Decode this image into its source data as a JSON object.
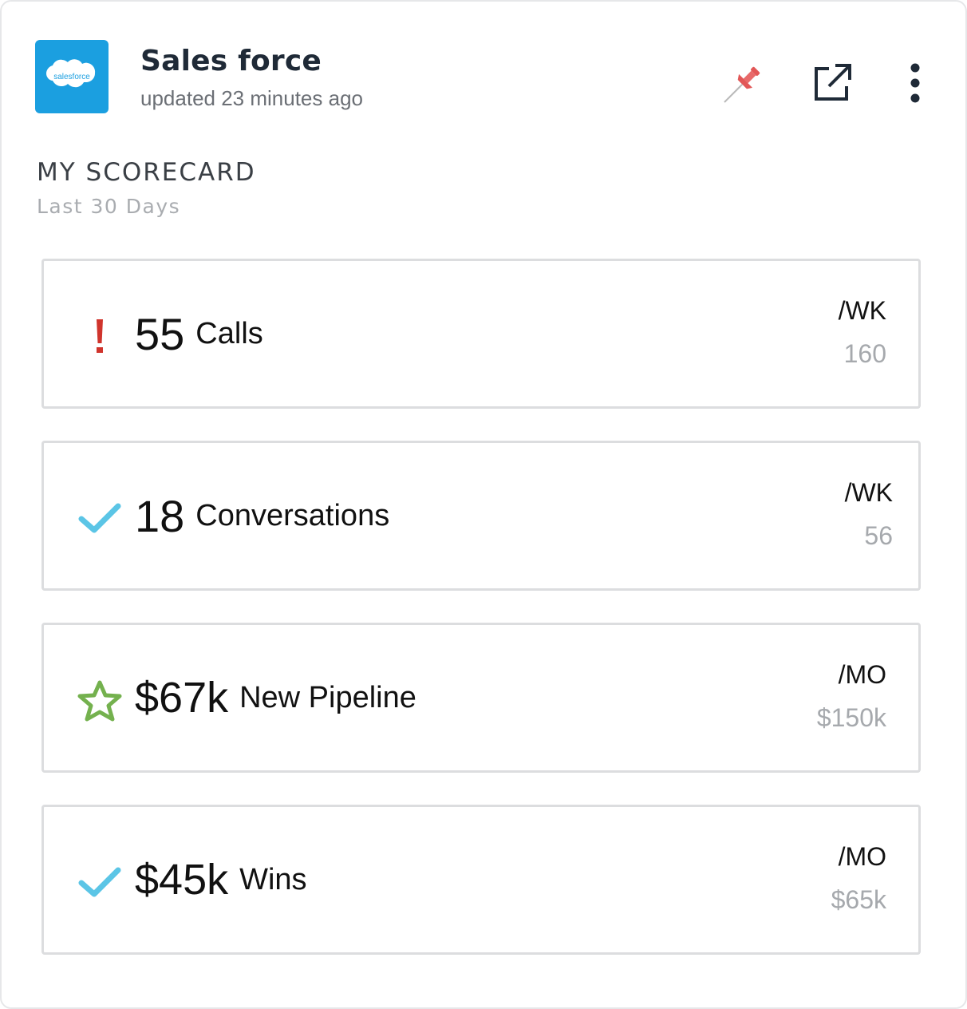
{
  "header": {
    "logo_text": "salesforce",
    "title": "Sales force",
    "updated": "updated 23 minutes ago",
    "icons": [
      "pin-icon",
      "external-link-icon",
      "more-vertical-icon"
    ]
  },
  "scorecard": {
    "title": "MY SCORECARD",
    "subtitle": "Last 30 Days"
  },
  "metrics": [
    {
      "status_icon": "exclamation-icon",
      "status_color": "#d0342c",
      "value": "55",
      "label": "Calls",
      "period": "/WK",
      "target": "160"
    },
    {
      "status_icon": "check-icon",
      "status_color": "#5bc5e6",
      "value": "18",
      "label": "Conversations",
      "period": "/WK",
      "target": "56"
    },
    {
      "status_icon": "star-icon",
      "status_color": "#74b14e",
      "value": "$67k",
      "label": "New Pipeline",
      "period": "/MO",
      "target": "$150k"
    },
    {
      "status_icon": "check-icon",
      "status_color": "#5bc5e6",
      "value": "$45k",
      "label": "Wins",
      "period": "/MO",
      "target": "$65k"
    }
  ],
  "colors": {
    "brand_blue": "#1b9fe0",
    "pin_red": "#e25757",
    "title_dark": "#1f2a37"
  }
}
